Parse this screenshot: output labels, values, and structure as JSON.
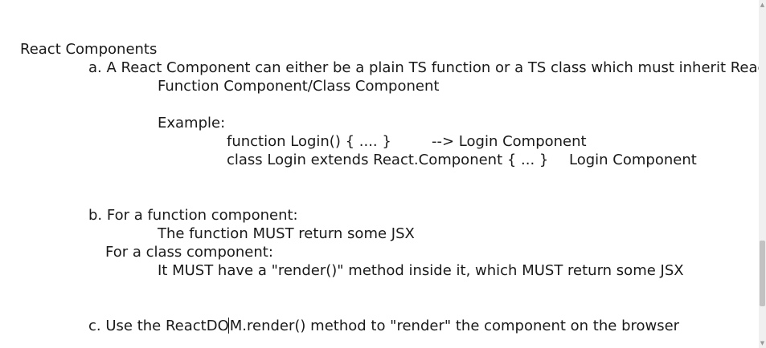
{
  "document": {
    "heading": "React Components",
    "point_a": "a. A React Component can either be a plain TS function or a TS class which must inherit React.Com",
    "point_a_sub": "Function Component/Class Component",
    "example_label": "Example:",
    "example_function_code": "function Login() { .... }",
    "example_function_result": "--> Login Component",
    "example_class_code": "class Login extends React.Component { ... }",
    "example_class_result": "Login Component",
    "point_b": "b. For a function component:",
    "point_b_function_rule": "The function MUST return some JSX",
    "point_b_class_label": "For a class component:",
    "point_b_class_rule": "It MUST have a \"render()\" method inside it, which MUST return some JSX",
    "point_c_before_caret": "c. Use the ReactDO",
    "point_c_after_caret": "M.render() method to \"render\" the component on the browser"
  },
  "scrollbar": {
    "up_arrow_icon": "chevron-up-icon",
    "down_arrow_icon": "chevron-down-icon"
  }
}
